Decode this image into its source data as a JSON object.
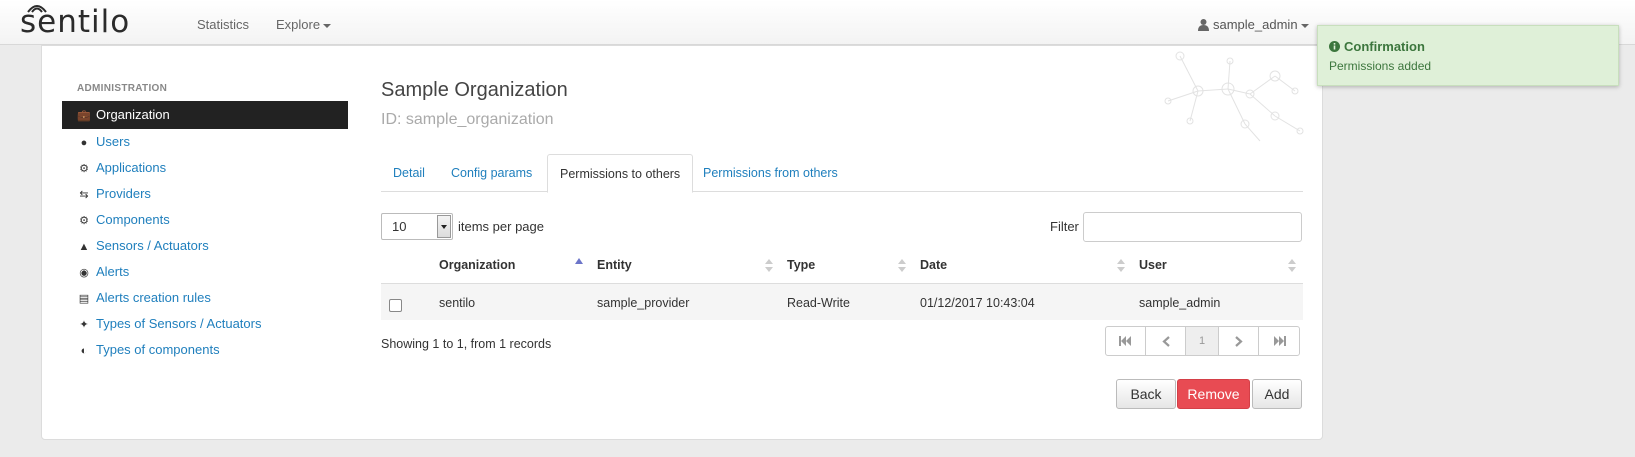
{
  "nav": {
    "logo_text": "sentilo",
    "links": [
      {
        "label": "Statistics"
      },
      {
        "label": "Explore"
      }
    ],
    "user": "sample_admin"
  },
  "sidebar": {
    "header": "ADMINISTRATION",
    "items": [
      {
        "label": "Organization",
        "icon": "briefcase-icon",
        "active": true
      },
      {
        "label": "Users",
        "icon": "user-icon"
      },
      {
        "label": "Applications",
        "icon": "gear-icon"
      },
      {
        "label": "Providers",
        "icon": "arrows-exchange-icon"
      },
      {
        "label": "Components",
        "icon": "gears-icon"
      },
      {
        "label": "Sensors / Actuators",
        "icon": "flask-icon"
      },
      {
        "label": "Alerts",
        "icon": "bell-icon"
      },
      {
        "label": "Alerts creation rules",
        "icon": "server-icon"
      },
      {
        "label": "Types of Sensors / Actuators",
        "icon": "wrench-icon"
      },
      {
        "label": "Types of components",
        "icon": "half-circle-icon"
      }
    ]
  },
  "main": {
    "title": "Sample Organization",
    "id_line": "ID: sample_organization",
    "tabs": [
      {
        "label": "Detail"
      },
      {
        "label": "Config params"
      },
      {
        "label": "Permissions to others",
        "active": true
      },
      {
        "label": "Permissions from others"
      }
    ],
    "items_per_page": {
      "value": "10",
      "label": "items per page"
    },
    "filter": {
      "label": "Filter",
      "value": ""
    },
    "table": {
      "columns": [
        "Organization",
        "Entity",
        "Type",
        "Date",
        "User"
      ],
      "rows": [
        {
          "organization": "sentilo",
          "entity": "sample_provider",
          "type": "Read-Write",
          "date": "01/12/2017 10:43:04",
          "user": "sample_admin"
        }
      ]
    },
    "showing": "Showing 1 to 1, from 1 records",
    "pagination": {
      "current_page": "1"
    },
    "buttons": {
      "back": "Back",
      "remove": "Remove",
      "add": "Add"
    }
  },
  "toast": {
    "title": "Confirmation",
    "message": "Permissions added",
    "color": "#dff0d8"
  },
  "colors": {
    "link": "#1f7fbd",
    "danger": "#e84b53",
    "sidebar_active": "#222222"
  }
}
